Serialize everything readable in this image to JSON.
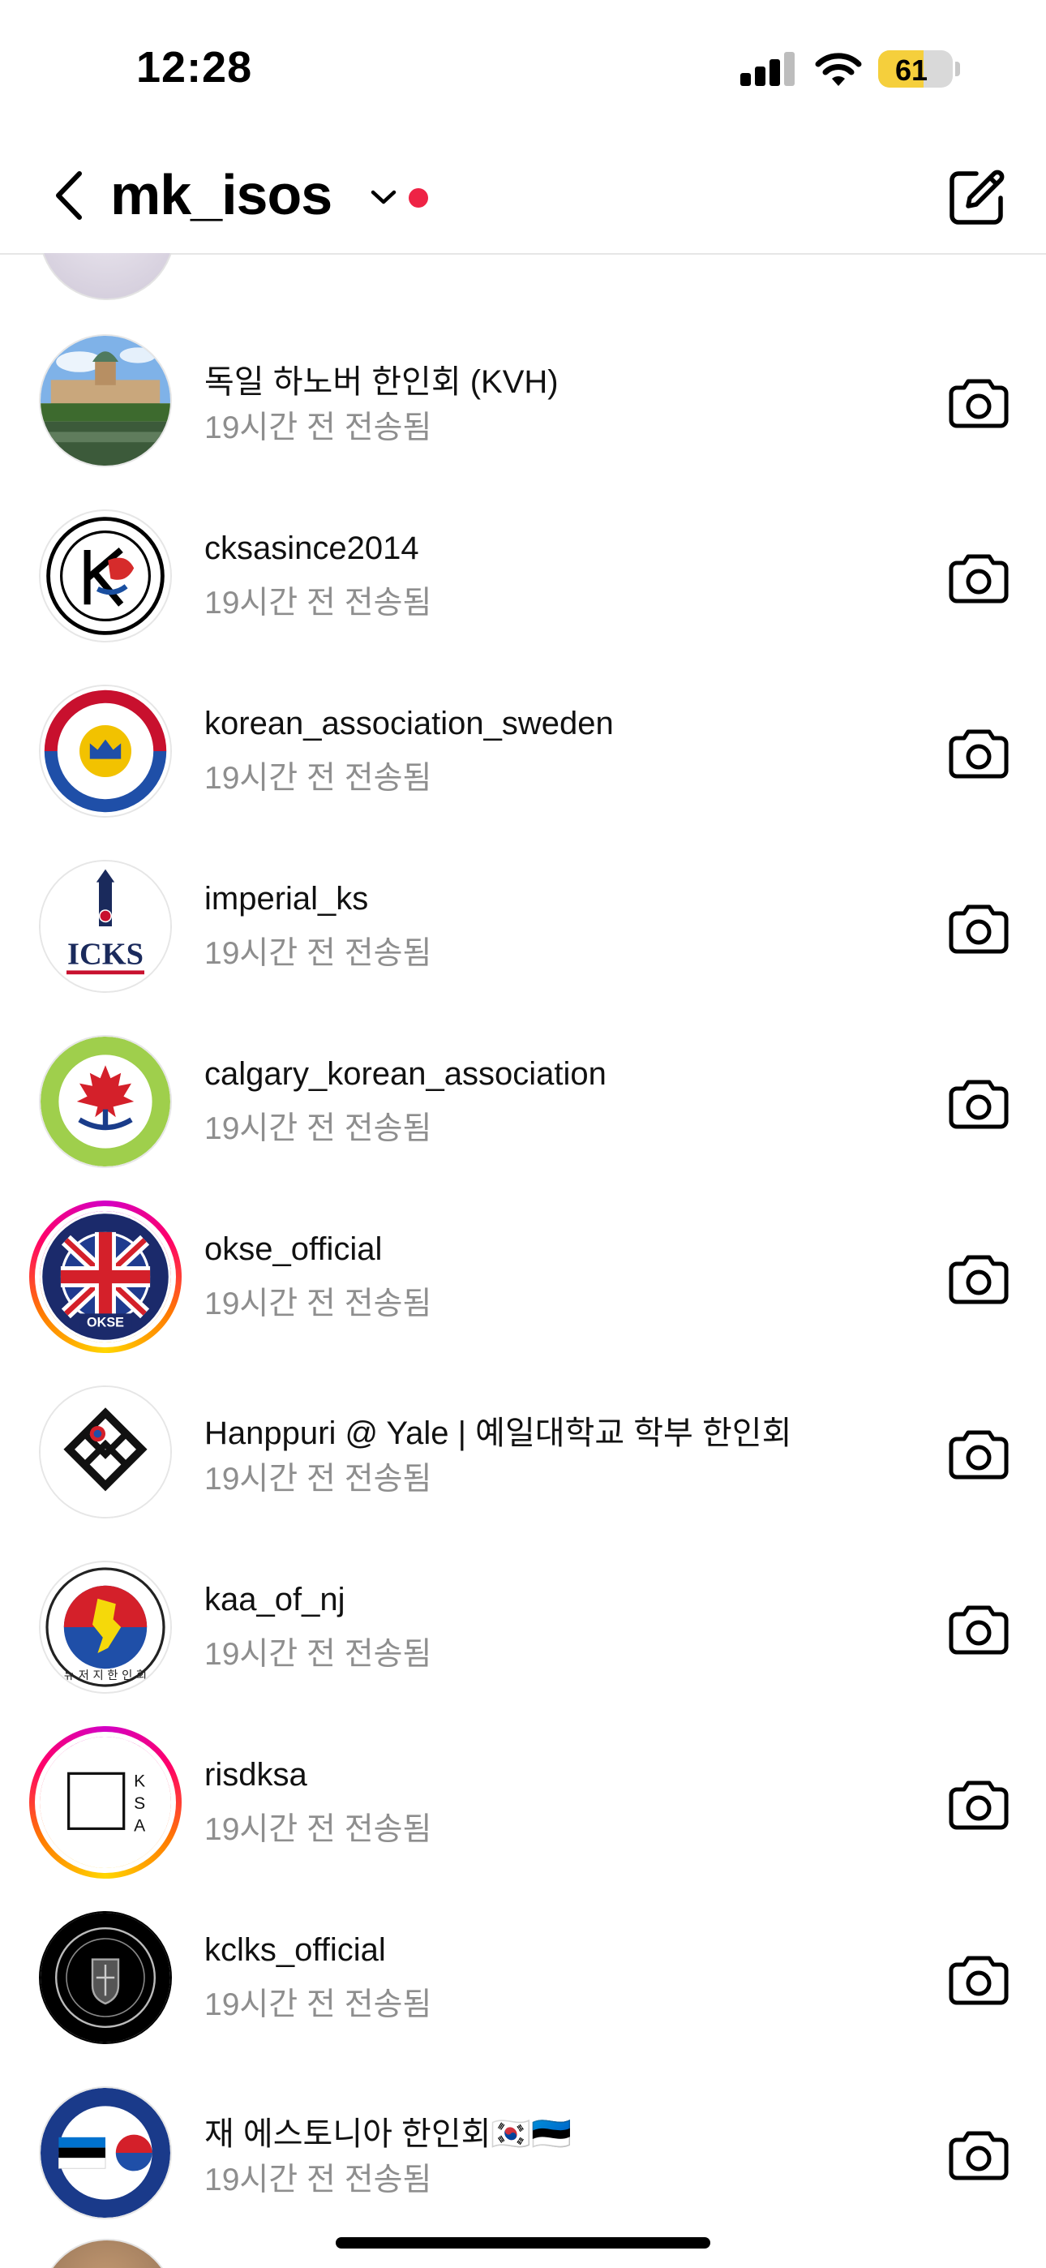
{
  "status_bar": {
    "time": "12:28",
    "battery": "61",
    "battery_level": 0.61
  },
  "header": {
    "username": "mk_isos"
  },
  "messages": [
    {
      "name": "독일 하노버 한인회 (KVH)",
      "status": "19시간 전 전송됨"
    },
    {
      "name": "cksasince2014",
      "status": "19시간 전 전송됨"
    },
    {
      "name": "korean_association_sweden",
      "status": "19시간 전 전송됨"
    },
    {
      "name": "imperial_ks",
      "status": "19시간 전 전송됨",
      "avatar_text": "ICKS"
    },
    {
      "name": "calgary_korean_association",
      "status": "19시간 전 전송됨"
    },
    {
      "name": "okse_official",
      "status": "19시간 전 전송됨",
      "avatar_text": "OKSE"
    },
    {
      "name": "Hanppuri @ Yale | 예일대학교 학부 한인회",
      "status": "19시간 전 전송됨"
    },
    {
      "name": "kaa_of_nj",
      "status": "19시간 전 전송됨"
    },
    {
      "name": "risdksa",
      "status": "19시간 전 전송됨",
      "avatar_letters": [
        "K",
        "S",
        "A"
      ]
    },
    {
      "name": "kclks_official",
      "status": "19시간 전 전송됨"
    },
    {
      "name": "재 에스토니아 한인회🇰🇷🇪🇪",
      "status": "19시간 전 전송됨"
    }
  ]
}
